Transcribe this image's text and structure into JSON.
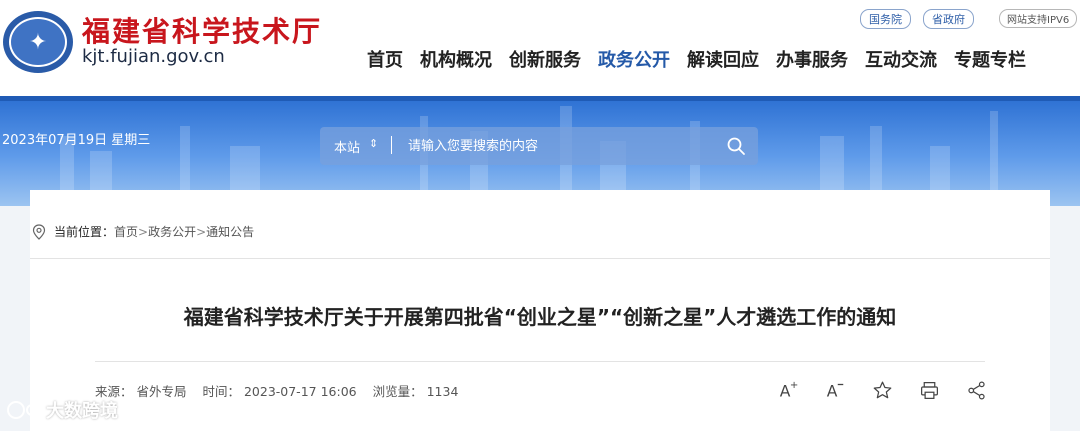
{
  "header": {
    "site_title": "福建省科学技术厅",
    "site_domain": "kjt.fujian.gov.cn",
    "top_links": [
      "国务院",
      "省政府"
    ],
    "ipv6": "网站支持IPV6",
    "nav": [
      "首页",
      "机构概况",
      "创新服务",
      "政务公开",
      "解读回应",
      "办事服务",
      "互动交流",
      "专题专栏"
    ],
    "nav_active": "政务公开"
  },
  "banner": {
    "date": "2023年07月19日  星期三",
    "search_scope": "本站",
    "search_placeholder": "请输入您要搜索的内容"
  },
  "breadcrumb": {
    "label": "当前位置：",
    "items": [
      "首页",
      "政务公开",
      "通知公告"
    ]
  },
  "article": {
    "title": "福建省科学技术厅关于开展第四批省“创业之星”“创新之星”人才遴选工作的通知",
    "source": "来源：  省外专局",
    "time": "时间：  2023-07-17 16:06",
    "views": "浏览量：  1134"
  },
  "watermark": "大数跨境",
  "colors": {
    "brand_red": "#c8161d",
    "brand_blue": "#2459a8"
  }
}
